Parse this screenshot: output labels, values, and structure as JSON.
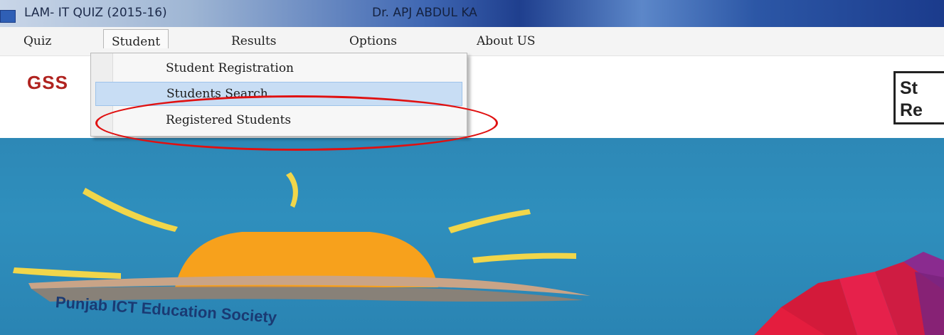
{
  "window": {
    "title": "LAM-  IT QUIZ (2015-16)",
    "title_extra": "Dr. APJ ABDUL KA"
  },
  "menu": {
    "items": [
      {
        "label": "Quiz"
      },
      {
        "label": "Student"
      },
      {
        "label": "Results"
      },
      {
        "label": "Options"
      },
      {
        "label": "About US"
      }
    ],
    "active": "Student"
  },
  "dropdown": {
    "items": [
      {
        "label": "Student Registration"
      },
      {
        "label": "Students Search"
      },
      {
        "label": "Registered Students"
      }
    ],
    "hovered": "Students Search",
    "highlighted": "Registered Students"
  },
  "header": {
    "school_abbrev": "GSS",
    "right_box": [
      "St",
      "Re"
    ]
  },
  "banner": {
    "logo_text": "Punjab ICT Education Society"
  },
  "colors": {
    "sun": "#f7a11c",
    "ray": "#f1d64a",
    "banner_bg": "#2d88b6",
    "highlight_circle": "#e01010",
    "menu_hover": "#c8ddf4"
  }
}
